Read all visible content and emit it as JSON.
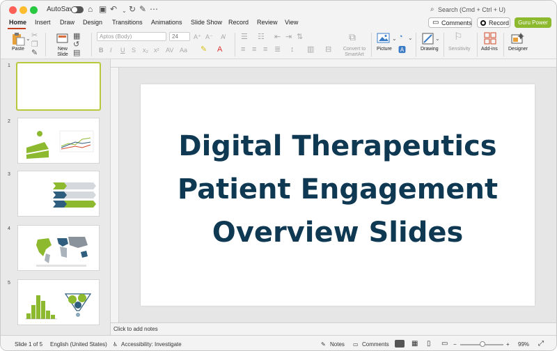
{
  "titlebar": {
    "autosave_label": "AutoSave",
    "search_label": "Search (Cmd + Ctrl + U)"
  },
  "tabs": [
    "Home",
    "Insert",
    "Draw",
    "Design",
    "Transitions",
    "Animations",
    "Slide Show",
    "Record",
    "Review",
    "View"
  ],
  "header_buttons": {
    "comments": "Comments",
    "record": "Record",
    "guru": "Guru Power"
  },
  "ribbon": {
    "paste": "Paste",
    "new_slide": "New Slide",
    "font_name": "Aptos (Body)",
    "font_size": "24",
    "convert_smartart": "Convert to SmartArt",
    "picture": "Picture",
    "drawing": "Drawing",
    "sensitivity": "Sensitivity",
    "addins": "Add-ins",
    "designer": "Designer"
  },
  "thumbnails": [
    {
      "number": "1"
    },
    {
      "number": "2"
    },
    {
      "number": "3"
    },
    {
      "number": "4"
    },
    {
      "number": "5"
    }
  ],
  "slide": {
    "title": "Digital Therapeutics\nPatient Engagement\nOverview Slides"
  },
  "notes_placeholder": "Click to add notes",
  "status": {
    "slide_count": "Slide 1 of 5",
    "language": "English (United States)",
    "accessibility": "Accessibility: Investigate",
    "notes": "Notes",
    "comments": "Comments",
    "zoom": "99%"
  },
  "colors": {
    "accent_green": "#8db92e",
    "title_navy": "#0f3852",
    "active_tab_red": "#c43e1c"
  }
}
